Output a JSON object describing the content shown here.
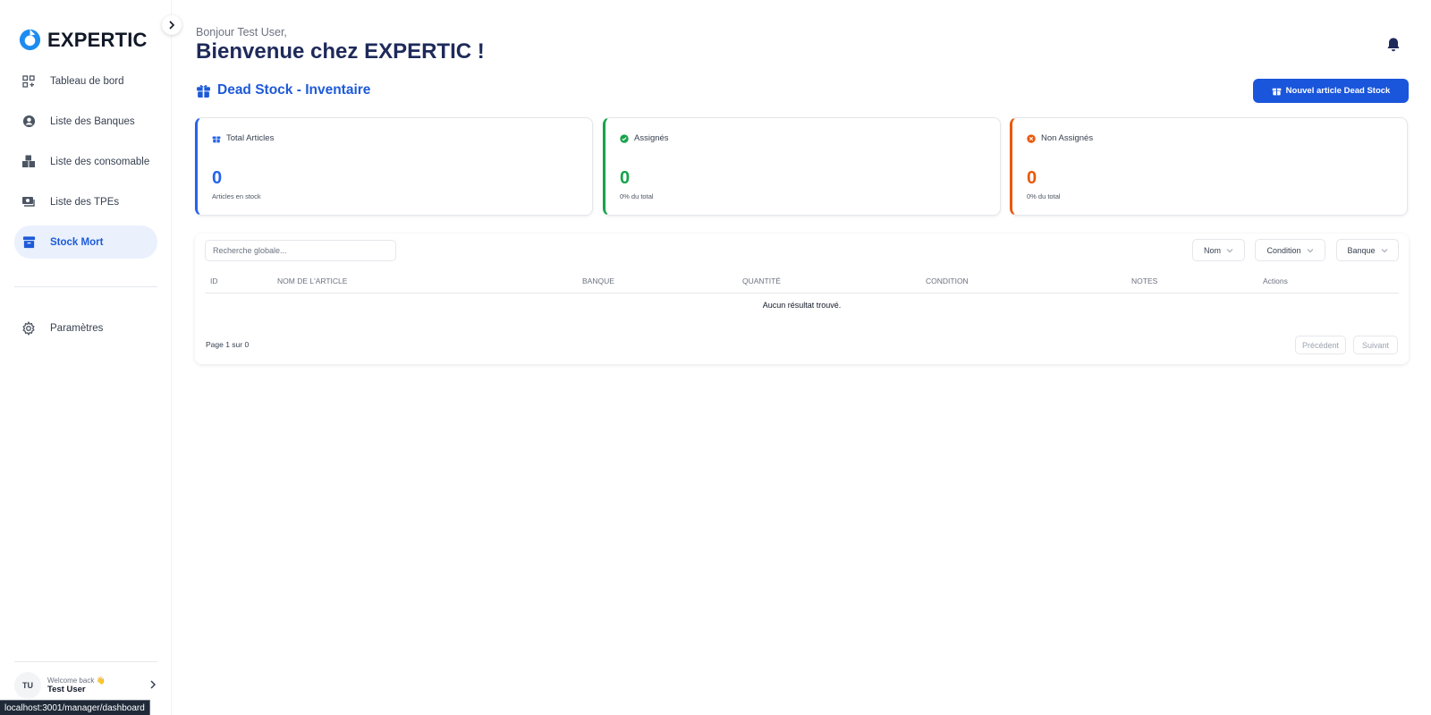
{
  "brand": {
    "name": "EXPERTIC",
    "color": "#1d8cf0"
  },
  "sidebar": {
    "items": [
      {
        "label": "Tableau de bord",
        "icon": "dashboard-icon"
      },
      {
        "label": "Liste des Banques",
        "icon": "user-circle-icon"
      },
      {
        "label": "Liste des consomable",
        "icon": "boxes-icon"
      },
      {
        "label": "Liste des TPEs",
        "icon": "money-icon"
      },
      {
        "label": "Stock Mort",
        "icon": "archive-icon",
        "active": true
      }
    ],
    "settings_label": "Paramètres",
    "user": {
      "initials": "TU",
      "welcome": "Welcome back 👋",
      "name": "Test User"
    }
  },
  "status_url": "localhost:3001/manager/dashboard",
  "header": {
    "greeting": "Bonjour Test User,",
    "title": "Bienvenue chez EXPERTIC !"
  },
  "page": {
    "title": "Dead Stock - Inventaire",
    "new_button": "Nouvel article Dead Stock"
  },
  "stats": [
    {
      "label": "Total Articles",
      "value": "0",
      "sub": "Articles en stock",
      "color": "#2563eb"
    },
    {
      "label": "Assignés",
      "value": "0",
      "sub": "0% du total",
      "color": "#16a34a"
    },
    {
      "label": "Non Assignés",
      "value": "0",
      "sub": "0% du total",
      "color": "#ea580c"
    }
  ],
  "table": {
    "search_placeholder": "Recherche globale...",
    "filters": [
      "Nom",
      "Condition",
      "Banque"
    ],
    "columns": [
      "ID",
      "Nom de l'article",
      "Banque",
      "Quantité",
      "Condition",
      "Notes",
      "Actions"
    ],
    "empty_text": "Aucun résultat trouvé.",
    "page_info": "Page 1 sur 0",
    "prev_label": "Précédent",
    "next_label": "Suivant"
  }
}
